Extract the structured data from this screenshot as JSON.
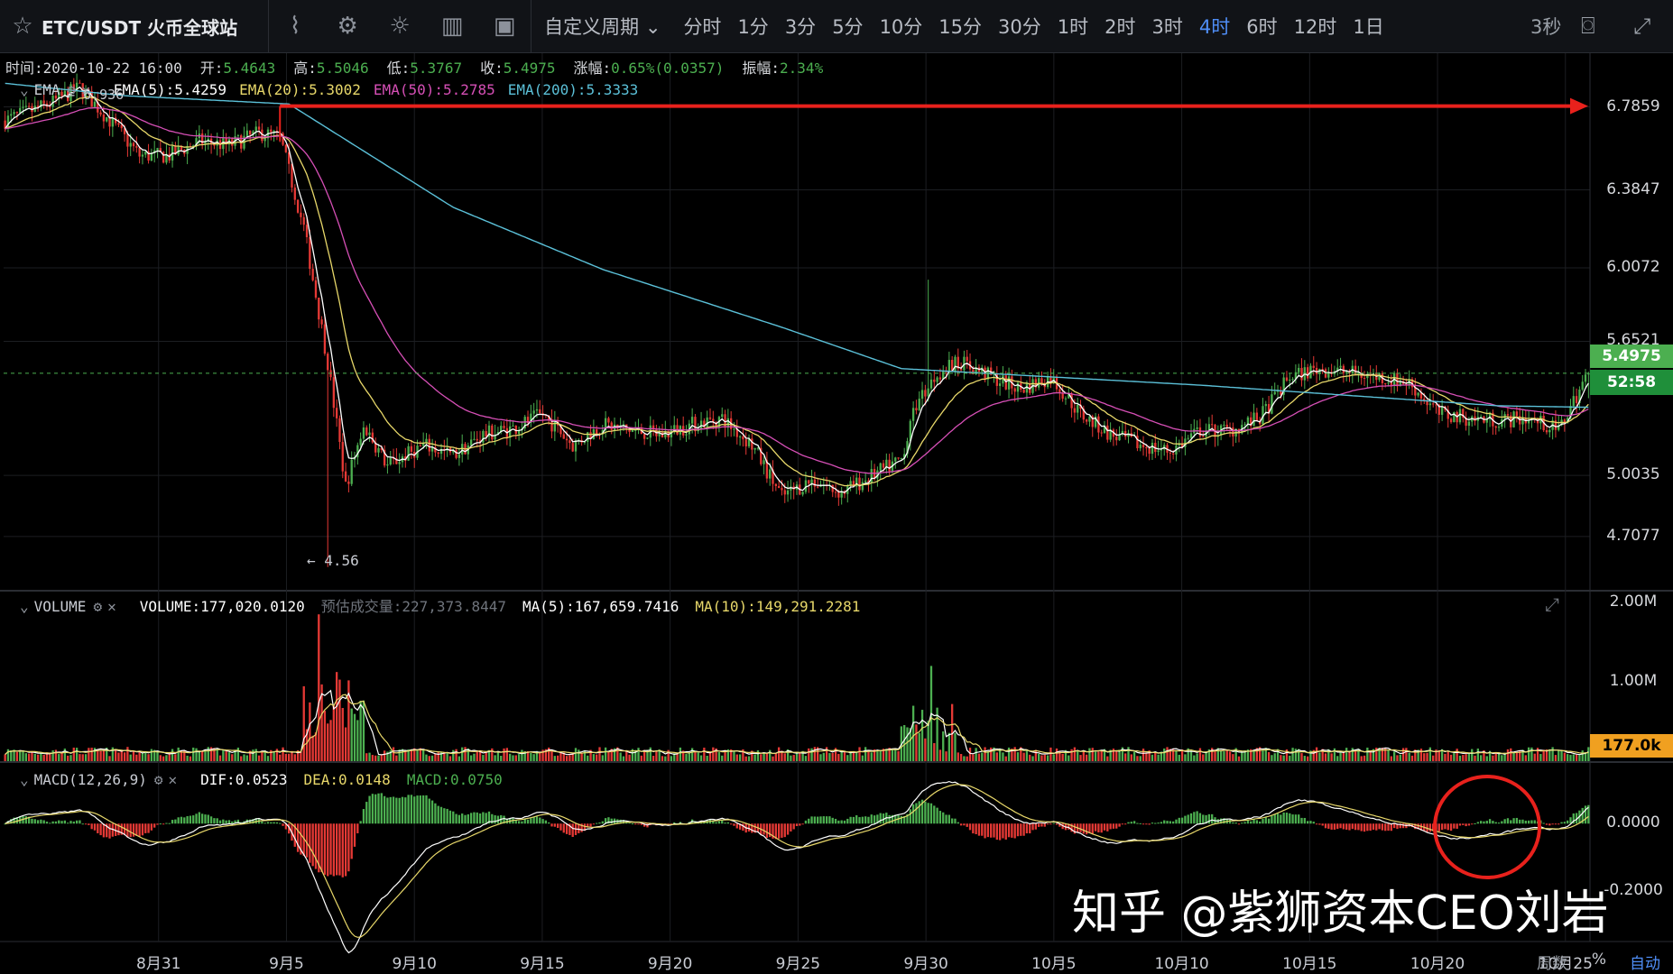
{
  "toolbar": {
    "symbol": "ETC/USDT 火币全球站",
    "custom_period": "自定义周期",
    "periods": [
      "分时",
      "1分",
      "3分",
      "5分",
      "10分",
      "15分",
      "30分",
      "1时",
      "2时",
      "3时",
      "4时",
      "6时",
      "12时",
      "1日"
    ],
    "active_period": "4时",
    "refresh": "3秒"
  },
  "info_line": {
    "time_label": "时间:",
    "time_value": "2020-10-22 16:00",
    "open_label": "开:",
    "open_value": "5.4643",
    "high_label": "高:",
    "high_value": "5.5046",
    "low_label": "低:",
    "low_value": "5.3767",
    "close_label": "收:",
    "close_value": "5.4975",
    "change_label": "涨幅:",
    "change_value": "0.65%(0.0357)",
    "amp_label": "振幅:",
    "amp_value": "2.34%"
  },
  "ema_legend": {
    "name": "EMA",
    "max_marker": "6.936",
    "ema5": "EMA(5):5.4259",
    "ema20": "EMA(20):5.3002",
    "ema50": "EMA(50):5.2785",
    "ema200": "EMA(200):5.3333"
  },
  "volume_legend": {
    "name": "VOLUME",
    "volume": "VOLUME:177,020.0120",
    "est": "预估成交量:227,373.8447",
    "ma5": "MA(5):167,659.7416",
    "ma10": "MA(10):149,291.2281"
  },
  "macd_legend": {
    "name": "MACD(12,26,9)",
    "dif": "DIF:0.0523",
    "dea": "DEA:0.0148",
    "macd": "MACD:0.0750"
  },
  "annotations": {
    "low_marker": "4.56",
    "current_price": "5.4975",
    "countdown": "52:58",
    "volume_badge": "177.0k"
  },
  "axis_bottom_right": {
    "scale": "周数",
    "percent": "%",
    "auto": "自动"
  },
  "watermark": "知乎 @紫狮资本CEO刘岩",
  "colors": {
    "up": "#4caf50",
    "down": "#e53935",
    "ema5": "#ffffff",
    "ema20": "#e8d86a",
    "ema50": "#d64fb6",
    "ema200": "#5bc0d8",
    "arrow": "#e8211c",
    "circle": "#e8211c"
  },
  "chart_data": {
    "type": "candlestick",
    "title": "ETC/USDT 4时",
    "x_ticks": [
      "8月31",
      "9月5",
      "9月10",
      "9月15",
      "9月20",
      "9月25",
      "9月30",
      "10月5",
      "10月10",
      "10月15",
      "10月20",
      "10月25"
    ],
    "y_ticks_price": [
      "6.7859",
      "6.3847",
      "6.0072",
      "5.6521",
      "5.0035",
      "4.7077"
    ],
    "y_ticks_volume": [
      "2.00M",
      "1.00M"
    ],
    "y_ticks_macd": [
      "0.0000",
      "-0.2000"
    ],
    "price_range": [
      4.45,
      7.05
    ],
    "close_path": [
      [
        0,
        6.72
      ],
      [
        15,
        6.8
      ],
      [
        25,
        6.88
      ],
      [
        35,
        6.72
      ],
      [
        45,
        6.55
      ],
      [
        55,
        6.55
      ],
      [
        65,
        6.62
      ],
      [
        75,
        6.6
      ],
      [
        85,
        6.66
      ],
      [
        92,
        6.64
      ],
      [
        100,
        6.2
      ],
      [
        108,
        5.55
      ],
      [
        114,
        4.95
      ],
      [
        120,
        5.25
      ],
      [
        128,
        5.05
      ],
      [
        140,
        5.15
      ],
      [
        150,
        5.1
      ],
      [
        160,
        5.2
      ],
      [
        170,
        5.23
      ],
      [
        180,
        5.3
      ],
      [
        190,
        5.15
      ],
      [
        200,
        5.25
      ],
      [
        210,
        5.22
      ],
      [
        220,
        5.2
      ],
      [
        230,
        5.25
      ],
      [
        240,
        5.28
      ],
      [
        250,
        5.15
      ],
      [
        260,
        4.9
      ],
      [
        270,
        4.98
      ],
      [
        280,
        4.92
      ],
      [
        290,
        5.0
      ],
      [
        300,
        5.08
      ],
      [
        305,
        5.35
      ],
      [
        312,
        5.5
      ],
      [
        320,
        5.55
      ],
      [
        330,
        5.48
      ],
      [
        340,
        5.42
      ],
      [
        350,
        5.48
      ],
      [
        360,
        5.3
      ],
      [
        370,
        5.2
      ],
      [
        380,
        5.15
      ],
      [
        390,
        5.12
      ],
      [
        400,
        5.22
      ],
      [
        410,
        5.22
      ],
      [
        420,
        5.28
      ],
      [
        430,
        5.48
      ],
      [
        440,
        5.52
      ],
      [
        450,
        5.5
      ],
      [
        460,
        5.48
      ],
      [
        470,
        5.45
      ],
      [
        480,
        5.3
      ],
      [
        490,
        5.28
      ],
      [
        500,
        5.27
      ],
      [
        510,
        5.28
      ],
      [
        520,
        5.22
      ],
      [
        527,
        5.42
      ],
      [
        530,
        5.5
      ]
    ],
    "ema5_last": 5.4259,
    "ema20_last": 5.3002,
    "ema50_last": 5.2785,
    "ema200_last": 5.3333,
    "ema200_path": [
      [
        0,
        6.9
      ],
      [
        40,
        6.84
      ],
      [
        95,
        6.8
      ],
      [
        150,
        6.3
      ],
      [
        200,
        6.0
      ],
      [
        260,
        5.72
      ],
      [
        300,
        5.52
      ],
      [
        350,
        5.48
      ],
      [
        400,
        5.44
      ],
      [
        450,
        5.39
      ],
      [
        500,
        5.34
      ],
      [
        530,
        5.333
      ]
    ],
    "last_close": 5.4975,
    "last_volume": 177020.012,
    "min_low": 4.56,
    "max_high": 6.936,
    "volume_range": [
      0,
      2.0
    ],
    "macd_range": [
      -0.35,
      0.18
    ],
    "macd_dif": 0.0523,
    "macd_dea": 0.0148,
    "macd_hist": 0.075
  }
}
